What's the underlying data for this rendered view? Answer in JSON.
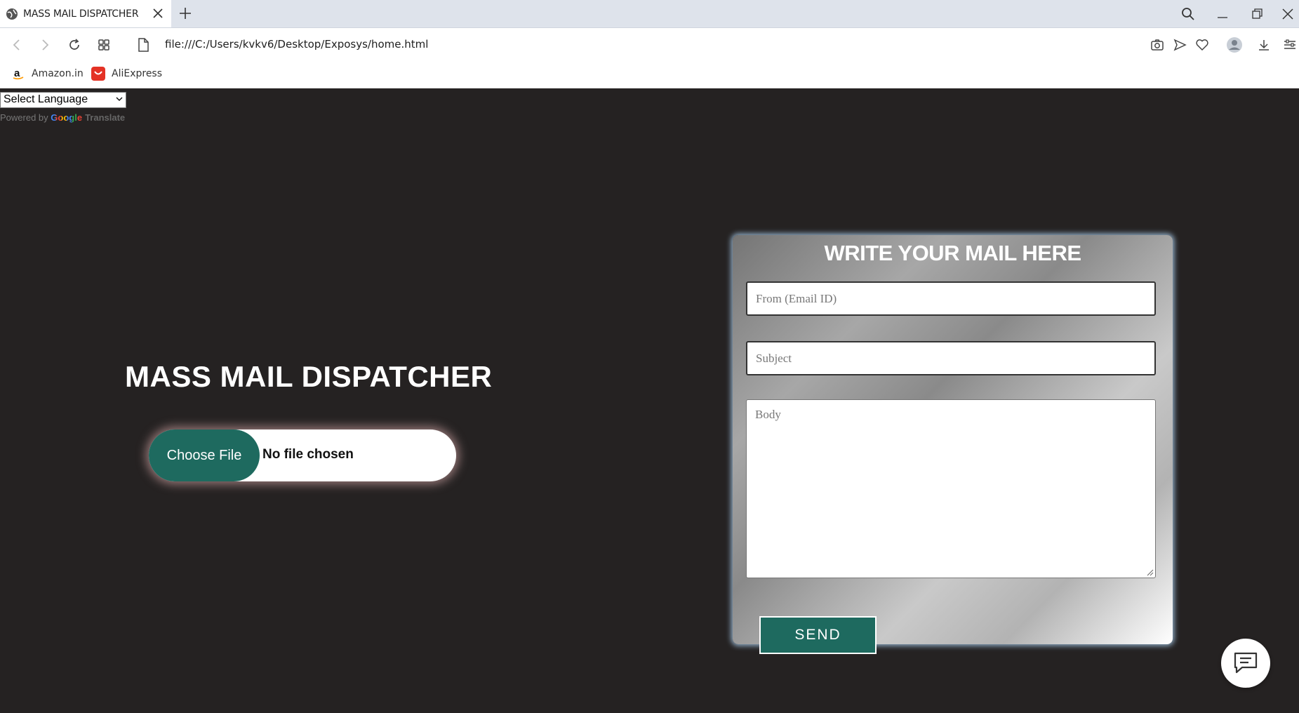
{
  "browser": {
    "tab_title": "MASS MAIL DISPATCHER",
    "url": "file:///C:/Users/kvkv6/Desktop/Exposys/home.html",
    "bookmarks": [
      {
        "label": "Amazon.in",
        "icon": "amazon-icon"
      },
      {
        "label": "AliExpress",
        "icon": "aliexpress-icon"
      }
    ]
  },
  "translate": {
    "select_label": "Select Language",
    "powered_by": "Powered by",
    "google": "Google",
    "translate": "Translate"
  },
  "main": {
    "title": "MASS MAIL DISPATCHER",
    "file_button": "Choose File",
    "file_status": "No file chosen"
  },
  "mail_form": {
    "title": "WRITE YOUR MAIL HERE",
    "from_placeholder": "From (Email ID)",
    "subject_placeholder": "Subject",
    "body_placeholder": "Body",
    "send_label": "SEND"
  },
  "colors": {
    "accent": "#1e6a5f",
    "background": "#252222"
  }
}
